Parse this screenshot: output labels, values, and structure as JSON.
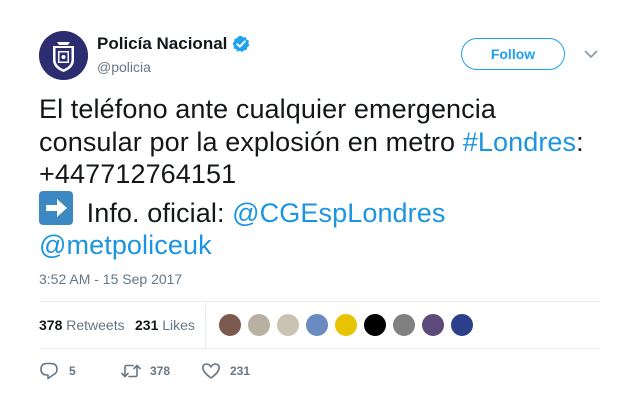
{
  "header": {
    "display_name": "Policía Nacional",
    "handle": "@policia",
    "verified_icon": "verified-badge-icon",
    "follow_label": "Follow",
    "menu_icon": "chevron-down-icon"
  },
  "tweet": {
    "text_line1": "El teléfono ante cualquier emergencia",
    "text_line2": "consular por la explosión en metro ",
    "hashtag": "#Londres",
    "after_hashtag": ":",
    "phone": "+447712764151",
    "arrow_emoji": "right-arrow-emoji-icon",
    "info_label": " Info. oficial: ",
    "mention1": "@CGEspLondres",
    "mention2": "@metpoliceuk",
    "timestamp": "3:52 AM - 15 Sep 2017"
  },
  "stats": {
    "retweets_count": "378",
    "retweets_label": "Retweets",
    "likes_count": "231",
    "likes_label": "Likes",
    "likers": [
      {
        "name": "liker-avatar-1",
        "color": "#7a5a4e"
      },
      {
        "name": "liker-avatar-2",
        "color": "#b8b0a0"
      },
      {
        "name": "liker-avatar-3",
        "color": "#c9c2b3"
      },
      {
        "name": "liker-avatar-4",
        "color": "#6a8bbf"
      },
      {
        "name": "liker-avatar-5",
        "color": "#e8c400"
      },
      {
        "name": "liker-avatar-6",
        "color": "#000000"
      },
      {
        "name": "liker-avatar-7",
        "color": "#808080"
      },
      {
        "name": "liker-avatar-8",
        "color": "#5b4a7a"
      },
      {
        "name": "liker-avatar-9",
        "color": "#2c3f8a"
      }
    ]
  },
  "actions": {
    "reply_icon": "reply-icon",
    "reply_count": "5",
    "retweet_icon": "retweet-icon",
    "retweet_count": "378",
    "like_icon": "heart-icon",
    "like_count": "231"
  },
  "colors": {
    "link": "#1b95e0",
    "brand": "#1da1f2",
    "muted": "#657786",
    "divider": "#e6ecf0"
  }
}
